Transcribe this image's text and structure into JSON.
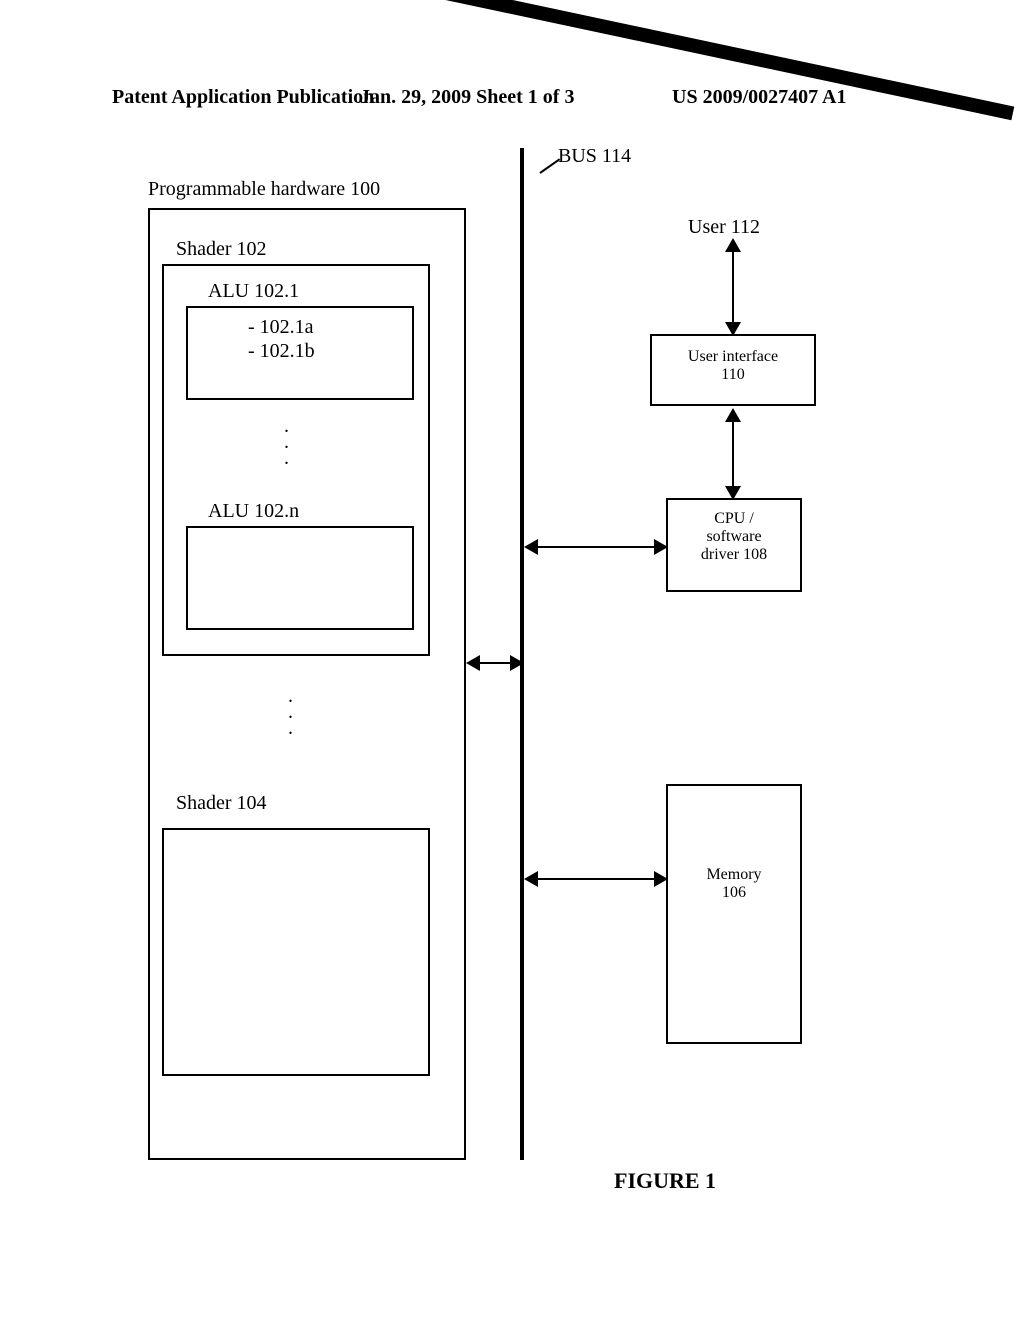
{
  "header": {
    "left": "Patent Application Publication",
    "center": "Jan. 29, 2009  Sheet 1 of 3",
    "right": "US 2009/0027407 A1"
  },
  "labels": {
    "bus": "BUS 114",
    "user": "User 112",
    "progHw": "Programmable hardware 100",
    "shader102": "Shader 102",
    "alu1": "ALU 102.1",
    "alu1a": "- 102.1a",
    "alu1b": "- 102.1b",
    "alun": "ALU 102.n",
    "shader104": "Shader 104",
    "ui_l1": "User interface",
    "ui_l2": "110",
    "cpu_l1": "CPU /",
    "cpu_l2": "software",
    "cpu_l3": "driver 108",
    "mem_l1": "Memory",
    "mem_l2": "106",
    "figure": "FIGURE 1"
  }
}
